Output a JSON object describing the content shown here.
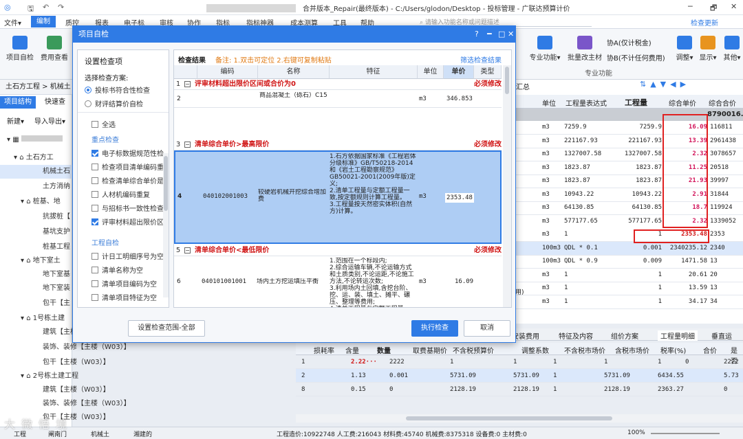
{
  "window": {
    "title": "合并版本_Repair(最终版本) - C:/Users/glodon/Desktop - 投标管理 - 广联达预算计价",
    "search_placeholder": "请输入功能名称或问题描述",
    "check_update": "检查更新"
  },
  "menu": [
    "文件▾",
    "编制",
    "质控",
    "报表",
    "电子标",
    "审核",
    "协作",
    "指标",
    "指标神器",
    "成本测算",
    "工具",
    "帮助"
  ],
  "ribbon": {
    "buttons": [
      "项目自检",
      "费用查看"
    ],
    "right_buttons": [
      "专业功能▾",
      "批量改主材",
      "调整▾",
      "显示▾",
      "其他▾"
    ],
    "tax_a": "协A(仅计税金)",
    "tax_b": "协B(不计任何费用)",
    "group_label": "专业功能",
    "rows_labels": [
      "土石方工程",
      "机械土"
    ]
  },
  "left_panel": {
    "tabs": [
      "项目结构",
      "快速查"
    ],
    "toolbar": [
      "新建▾",
      "导入导出▾"
    ],
    "tree": [
      "土石方工",
      "机械土石",
      "土方消纳",
      "桩基、地",
      "抗拔桩【",
      "基坑支护",
      "桩基工程",
      "地下室土",
      "地下室基",
      "地下室装",
      "包干【主",
      "1号栋土建",
      "建筑【主楼",
      "装饰、装修【主楼（W03）】",
      "包干【主楼（W03）】",
      "2号栋土建工程",
      "建筑【主楼（W03）】",
      "装饰、装修【主楼（W03）】",
      "包干【主楼（W03）】"
    ]
  },
  "dialog": {
    "title": "项目自检",
    "settings_title": "设置检查项",
    "scheme_label": "选择检查方案:",
    "scheme_options": [
      "投标书符合性检查",
      "财评结算价自检"
    ],
    "select_all": "全选",
    "section_key": "重点检查",
    "key_items": [
      "电子标数据规范性检",
      "检查项目清单编码重",
      "检查清单综合单价是",
      "人材机编码重复",
      "与招标书一致性检查",
      "评审材料超出限价区"
    ],
    "key_checked": [
      true,
      false,
      false,
      false,
      false,
      true
    ],
    "section_self": "工程自检",
    "self_items": [
      "计日工明细序号为空",
      "清单名称为空",
      "清单项目编码为空",
      "清单项目特征为空"
    ],
    "results_title": "检查结果",
    "results_note": "备注: 1.双击可定位 2.右键可复制粘贴",
    "filter_link": "筛选检查结果",
    "columns": [
      "编码",
      "名称",
      "特征",
      "单位",
      "单价",
      "类型"
    ],
    "groups": [
      {
        "num": "1",
        "label": "评审材料超出限价区间或合价为0",
        "type": "必须修改"
      },
      {
        "num": "3",
        "label": "清单综合单价>最高限价",
        "type": "必须修改"
      },
      {
        "num": "5",
        "label": "清单综合单价<最低限价",
        "type": "必须修改"
      }
    ],
    "rows": [
      {
        "num": "2",
        "code": "",
        "name": "商品混凝土（砾石）C15",
        "feature": "",
        "unit": "m3",
        "price": "346.853"
      },
      {
        "num": "4",
        "code": "040102001003",
        "name": "较硬岩机械开挖综合增加费",
        "feature": "1.石方依据国家标准《工程岩体分级标准》GB/T50218-2014和《岩土工程勘察规范》GB50021-2001(2009年版)定义;\n2.清单工程量与定额工程量一致,按定额规则计算工程量。\n3.工程量按天然密实体积(自然方)计算。",
        "unit": "m3",
        "price": "2353.48"
      },
      {
        "num": "6",
        "code": "040101001001",
        "name": "场内土方挖运填压平衡",
        "feature": "1.范围在一个标段内;\n2.综合运输车辆,不论运输方式和土质类别,不论运距,不论施工方法,不论转运次数;\n3.利用场内土回填,含挖台阶、挖、运、装、填土、摊平、碾压、整理等费用;\n4.清单工程量与定额工程量",
        "unit": "m3",
        "price": "16.09"
      }
    ],
    "btn_scope": "设置检查范围-全部",
    "btn_run": "执行检查",
    "btn_cancel": "取消"
  },
  "main_grid": {
    "toolbar_label": "汇总",
    "headers": [
      "单位",
      "工程量表达式",
      "工程量",
      "综合单价",
      "综合合价"
    ],
    "total_partial": "8790016.",
    "rows": [
      {
        "unit": "m3",
        "expr": "7259.9",
        "qty": "7259.9",
        "price": "16.09",
        "total": "116811"
      },
      {
        "unit": "m3",
        "expr": "221167.93",
        "qty": "221167.93",
        "price": "13.39",
        "total": "2961438"
      },
      {
        "unit": "m3",
        "expr": "1327007.58",
        "qty": "1327007.58",
        "price": "2.32",
        "total": "3078657"
      },
      {
        "unit": "m3",
        "expr": "1823.87",
        "qty": "1823.87",
        "price": "11.25",
        "total": "20518"
      },
      {
        "unit": "m3",
        "expr": "1823.87",
        "qty": "1823.87",
        "price": "21.93",
        "total": "39997"
      },
      {
        "unit": "m3",
        "expr": "10943.22",
        "qty": "10943.22",
        "price": "2.91",
        "total": "31844"
      },
      {
        "unit": "m3",
        "expr": "64130.85",
        "qty": "64130.85",
        "price": "18.7",
        "total": "119924"
      },
      {
        "unit": "m3",
        "expr": "577177.65",
        "qty": "577177.65",
        "price": "2.32",
        "total": "1339052"
      },
      {
        "unit": "m3",
        "expr": "1",
        "qty": "1",
        "price": "2353.48",
        "total": "2353"
      },
      {
        "unit": "100m3",
        "expr": "QDL * 0.1",
        "qty": "0.001",
        "price": "2340235.12",
        "total": "2340"
      },
      {
        "unit": "100m3",
        "expr": "QDL * 0.9",
        "qty": "0.009",
        "price": "1471.58",
        "total": "13"
      },
      {
        "unit": "m3",
        "expr": "1",
        "qty": "1",
        "price": "20.61",
        "total": "20"
      },
      {
        "unit": "m3",
        "expr": "1",
        "qty": "1",
        "price": "13.59",
        "total": "13"
      },
      {
        "unit": "m3",
        "expr": "1",
        "qty": "1",
        "price": "34.17",
        "total": "34"
      }
    ],
    "side_label": "费用)"
  },
  "bottom_tabs": [
    "安装费用",
    "特征及内容",
    "组价方案",
    "工程量明细",
    "垂直运"
  ],
  "bottom_grid": {
    "headers": [
      "损耗率",
      "含量",
      "数量",
      "取费基期价",
      "不含税预算价",
      "调整系数",
      "不含税市场价",
      "含税市场价",
      "税率(%)",
      "合价",
      "是否"
    ],
    "rows": [
      {
        "num": "1",
        "loss": "",
        "content": "2.22···",
        "qty": "2222",
        "base": "1",
        "pre": "1",
        "adj": "1",
        "mkt": "1",
        "mkt_tax": "1",
        "rate": "0",
        "total": "2222"
      },
      {
        "num": "2",
        "loss": "",
        "content": "1.13",
        "qty": "0.001",
        "base": "5731.09",
        "pre": "5731.09",
        "adj": "1",
        "mkt": "5731.09",
        "mkt_tax": "6434.55",
        "rate": "",
        "total": "5.73"
      },
      {
        "num": "8",
        "loss": "",
        "content": "0.15",
        "qty": "0",
        "base": "2128.19",
        "pre": "2128.19",
        "adj": "1",
        "mkt": "2128.19",
        "mkt_tax": "2363.27",
        "rate": "",
        "total": "0"
      }
    ]
  },
  "statusbar": {
    "tabs": [
      "工程",
      "阐南门",
      "机械土",
      "湘建的"
    ],
    "summary": "工程造价:10922748  人工费:216043  材料费:45740  机械费:8375318  设备费:0  主材费:0",
    "zoom": "100%"
  },
  "watermark": "大 微 悟 境",
  "colors": {
    "accent": "#2f7be5",
    "highlight": "#d2145a",
    "warning": "#d01515"
  }
}
